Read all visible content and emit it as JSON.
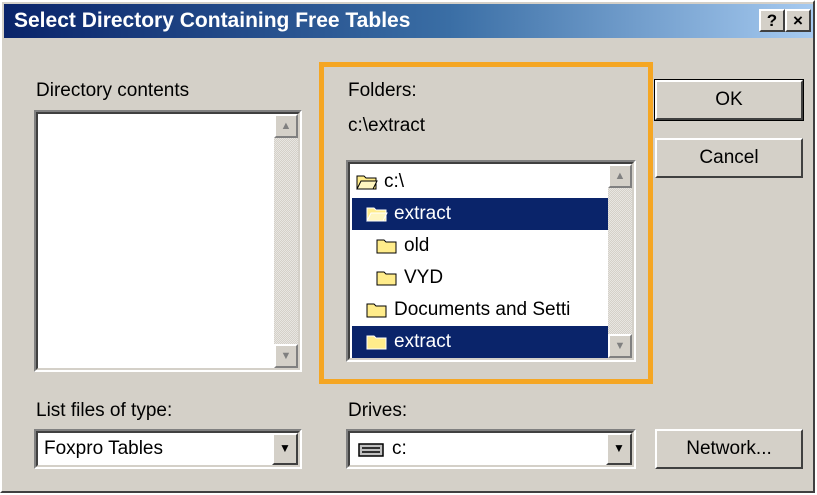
{
  "dialog": {
    "title": "Select Directory Containing Free Tables",
    "help_btn": "?",
    "close_btn": "×"
  },
  "directory_contents": {
    "label": "Directory contents"
  },
  "folders": {
    "label": "Folders:",
    "current_path": "c:\\extract",
    "items": [
      {
        "name": "c:\\",
        "icon": "open-folder-icon",
        "selected": false
      },
      {
        "name": "extract",
        "icon": "open-folder-icon",
        "selected": true
      },
      {
        "name": "old",
        "icon": "folder-icon",
        "selected": false
      },
      {
        "name": "VYD",
        "icon": "folder-icon",
        "selected": false
      },
      {
        "name": "Documents and Setti",
        "icon": "folder-icon",
        "selected": false
      },
      {
        "name": "extract",
        "icon": "folder-icon",
        "selected": true
      }
    ]
  },
  "buttons": {
    "ok": "OK",
    "cancel": "Cancel",
    "network": "Network..."
  },
  "file_type": {
    "label": "List files of type:",
    "value": "Foxpro Tables"
  },
  "drives": {
    "label": "Drives:",
    "value": "c:",
    "icon": "drive-icon"
  },
  "colors": {
    "highlight": "#f5a623",
    "selection": "#0a246a",
    "face": "#d4d0c8"
  }
}
